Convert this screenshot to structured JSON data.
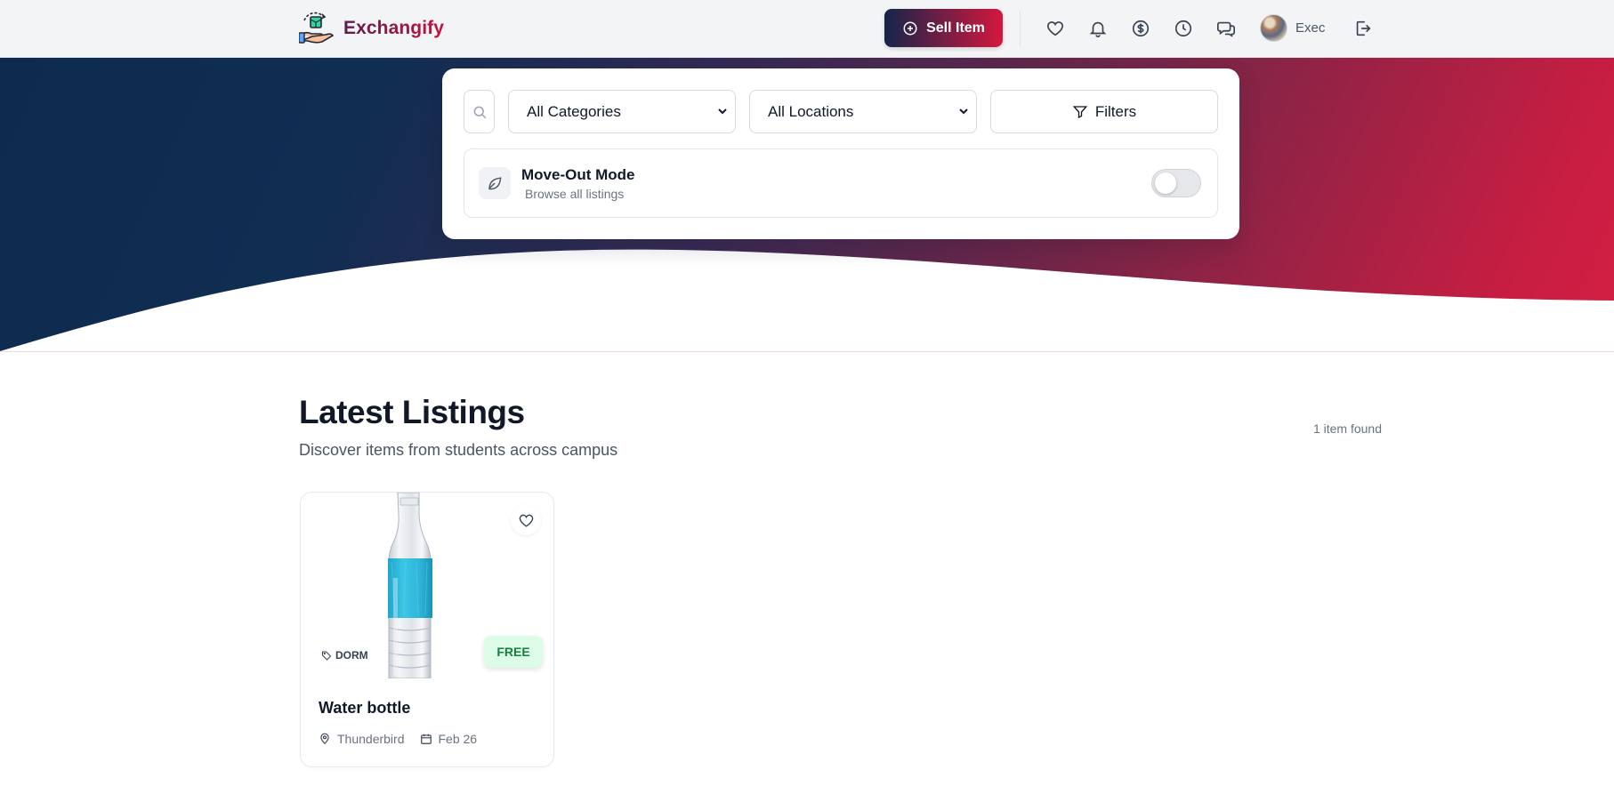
{
  "app": {
    "name": "Exchangify"
  },
  "header": {
    "sell_label": "Sell Item",
    "user_name": "Exec",
    "icons": [
      "heart-icon",
      "bell-icon",
      "dollar-icon",
      "clock-icon",
      "messages-icon",
      "logout-icon"
    ]
  },
  "search": {
    "category_value": "All Categories",
    "location_value": "All Locations",
    "filters_label": "Filters"
  },
  "move_out": {
    "title": "Move-Out Mode",
    "subtitle": "Browse all listings",
    "enabled": false
  },
  "listings": {
    "title": "Latest Listings",
    "subtitle": "Discover items from students across campus",
    "count_text": "1 item found",
    "items": [
      {
        "title": "Water bottle",
        "category": "DORM",
        "price": "FREE",
        "location": "Thunderbird",
        "date": "Feb 26"
      }
    ]
  },
  "colors": {
    "brand_start": "#14254a",
    "brand_end": "#d5173e",
    "free_badge_bg": "#dcfce7",
    "free_badge_text": "#15803d"
  }
}
